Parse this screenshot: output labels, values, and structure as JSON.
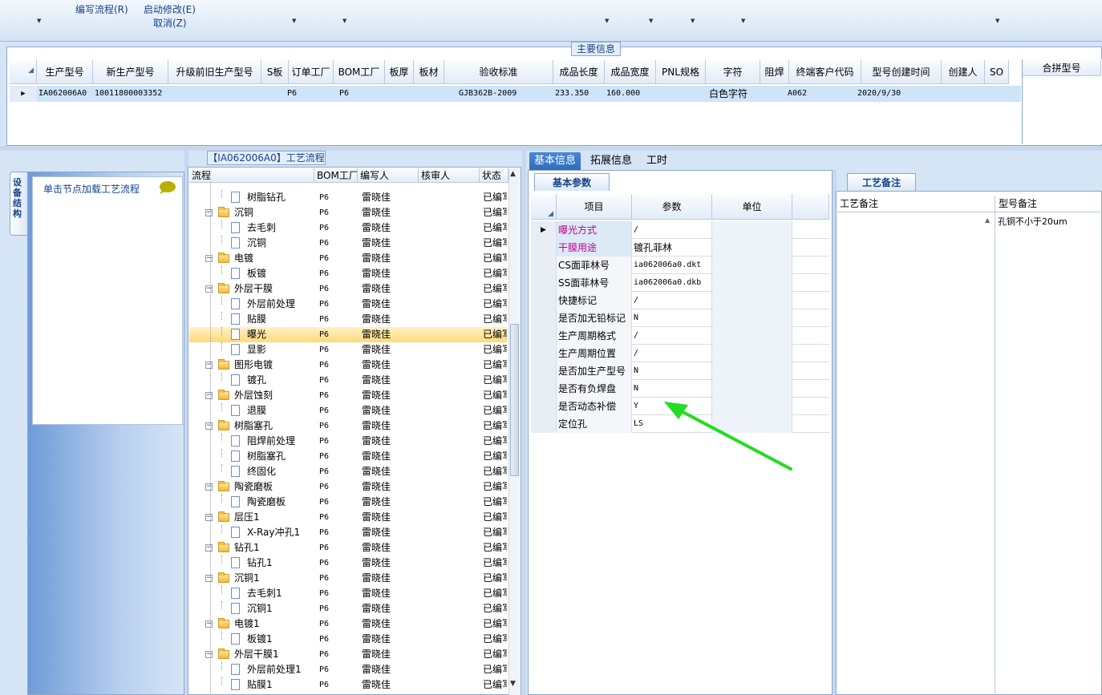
{
  "toolbar": {
    "write_flow": "编写流程(R)",
    "start_modify": "启动修改(E)",
    "cancel": "取消(Z)"
  },
  "main_info": {
    "title": "主要信息",
    "columns": [
      "生产型号",
      "新生产型号",
      "升级前旧生产型号",
      "S板",
      "订单工厂",
      "BOM工厂",
      "板厚",
      "板材",
      "验收标准",
      "成品长度",
      "成品宽度",
      "PNL规格",
      "字符",
      "阻焊",
      "终端客户代码",
      "型号创建时间",
      "创建人",
      "SO"
    ],
    "row": {
      "prod_model": "IA062006A0",
      "new_model": "10011800003352",
      "bom_factory": "P6",
      "order_factory": "P6",
      "standard": "GJB362B-2009",
      "length": "233.350",
      "width": "160.000",
      "char": "白色字符",
      "customer": "A062",
      "created": "2020/9/30"
    },
    "merge_header": "合拼型号"
  },
  "left": {
    "vtab": "设备结构",
    "load_hint": "单击节点加载工艺流程"
  },
  "tree": {
    "title": "【IA062006A0】工艺流程",
    "columns": [
      "流程",
      "BOM工厂",
      "编写人",
      "核审人",
      "状态"
    ],
    "rows": [
      {
        "name": "树脂钻孔",
        "level": 2,
        "factory": "P6",
        "author": "雷晓佳",
        "status": "已编写"
      },
      {
        "name": "沉铜",
        "level": 1,
        "factory": "P6",
        "author": "雷晓佳",
        "status": "已编写"
      },
      {
        "name": "去毛刺",
        "level": 2,
        "factory": "P6",
        "author": "雷晓佳",
        "status": "已编写"
      },
      {
        "name": "沉铜",
        "level": 2,
        "factory": "P6",
        "author": "雷晓佳",
        "status": "已编写"
      },
      {
        "name": "电镀",
        "level": 1,
        "factory": "P6",
        "author": "雷晓佳",
        "status": "已编写"
      },
      {
        "name": "板镀",
        "level": 2,
        "factory": "P6",
        "author": "雷晓佳",
        "status": "已编写"
      },
      {
        "name": "外层干膜",
        "level": 1,
        "factory": "P6",
        "author": "雷晓佳",
        "status": "已编写"
      },
      {
        "name": "外层前处理",
        "level": 2,
        "factory": "P6",
        "author": "雷晓佳",
        "status": "已编写"
      },
      {
        "name": "贴膜",
        "level": 2,
        "factory": "P6",
        "author": "雷晓佳",
        "status": "已编写"
      },
      {
        "name": "曝光",
        "level": 2,
        "factory": "P6",
        "author": "雷晓佳",
        "status": "已编写",
        "selected": true
      },
      {
        "name": "显影",
        "level": 2,
        "factory": "P6",
        "author": "雷晓佳",
        "status": "已编写"
      },
      {
        "name": "图形电镀",
        "level": 1,
        "factory": "P6",
        "author": "雷晓佳",
        "status": "已编写"
      },
      {
        "name": "镀孔",
        "level": 2,
        "factory": "P6",
        "author": "雷晓佳",
        "status": "已编写"
      },
      {
        "name": "外层蚀刻",
        "level": 1,
        "factory": "P6",
        "author": "雷晓佳",
        "status": "已编写"
      },
      {
        "name": "退膜",
        "level": 2,
        "factory": "P6",
        "author": "雷晓佳",
        "status": "已编写"
      },
      {
        "name": "树脂塞孔",
        "level": 1,
        "factory": "P6",
        "author": "雷晓佳",
        "status": "已编写"
      },
      {
        "name": "阻焊前处理",
        "level": 2,
        "factory": "P6",
        "author": "雷晓佳",
        "status": "已编写"
      },
      {
        "name": "树脂塞孔",
        "level": 2,
        "factory": "P6",
        "author": "雷晓佳",
        "status": "已编写"
      },
      {
        "name": "终固化",
        "level": 2,
        "factory": "P6",
        "author": "雷晓佳",
        "status": "已编写"
      },
      {
        "name": "陶瓷磨板",
        "level": 1,
        "factory": "P6",
        "author": "雷晓佳",
        "status": "已编写"
      },
      {
        "name": "陶瓷磨板",
        "level": 2,
        "factory": "P6",
        "author": "雷晓佳",
        "status": "已编写"
      },
      {
        "name": "层压1",
        "level": 1,
        "factory": "P6",
        "author": "雷晓佳",
        "status": "已编写"
      },
      {
        "name": "X-Ray冲孔1",
        "level": 2,
        "factory": "P6",
        "author": "雷晓佳",
        "status": "已编写"
      },
      {
        "name": "钻孔1",
        "level": 1,
        "factory": "P6",
        "author": "雷晓佳",
        "status": "已编写"
      },
      {
        "name": "钻孔1",
        "level": 2,
        "factory": "P6",
        "author": "雷晓佳",
        "status": "已编写"
      },
      {
        "name": "沉铜1",
        "level": 1,
        "factory": "P6",
        "author": "雷晓佳",
        "status": "已编写"
      },
      {
        "name": "去毛刺1",
        "level": 2,
        "factory": "P6",
        "author": "雷晓佳",
        "status": "已编写"
      },
      {
        "name": "沉铜1",
        "level": 2,
        "factory": "P6",
        "author": "雷晓佳",
        "status": "已编写"
      },
      {
        "name": "电镀1",
        "level": 1,
        "factory": "P6",
        "author": "雷晓佳",
        "status": "已编写"
      },
      {
        "name": "板镀1",
        "level": 2,
        "factory": "P6",
        "author": "雷晓佳",
        "status": "已编写"
      },
      {
        "name": "外层干膜1",
        "level": 1,
        "factory": "P6",
        "author": "雷晓佳",
        "status": "已编写"
      },
      {
        "name": "外层前处理1",
        "level": 2,
        "factory": "P6",
        "author": "雷晓佳",
        "status": "已编写"
      },
      {
        "name": "贴膜1",
        "level": 2,
        "factory": "P6",
        "author": "雷晓佳",
        "status": "已编写"
      }
    ]
  },
  "tabs": [
    "基本信息",
    "拓展信息",
    "工时"
  ],
  "basic": {
    "subtab": "基本参数",
    "columns": [
      "项目",
      "参数",
      "单位"
    ],
    "rows": [
      {
        "item": "曝光方式",
        "value": "/",
        "highlight": true
      },
      {
        "item": "干膜用途",
        "value": "镀孔菲林",
        "highlight": true
      },
      {
        "item": "CS面菲林号",
        "value": "ia062006a0.dkt"
      },
      {
        "item": "SS面菲林号",
        "value": "ia062006a0.dkb"
      },
      {
        "item": "快捷标记",
        "value": "/"
      },
      {
        "item": "是否加无铅标记",
        "value": "N"
      },
      {
        "item": "生产周期格式",
        "value": "/"
      },
      {
        "item": "生产周期位置",
        "value": "/"
      },
      {
        "item": "是否加生产型号",
        "value": "N"
      },
      {
        "item": "是否有负焊盘",
        "value": "N"
      },
      {
        "item": "是否动态补偿",
        "value": "Y"
      },
      {
        "item": "定位孔",
        "value": "LS"
      }
    ],
    "highlight_color": "#c0008c"
  },
  "remarks": {
    "tab": "工艺备注",
    "col_process": "工艺备注",
    "col_model": "型号备注",
    "model_remark": "孔铜不小于20um"
  },
  "arrow_color": "#22dd22"
}
